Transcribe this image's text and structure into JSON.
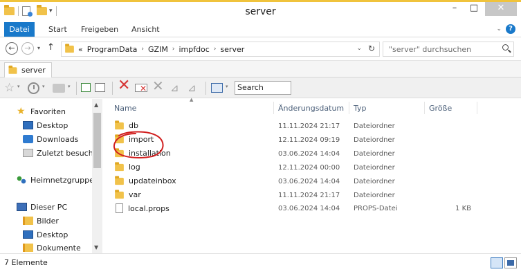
{
  "window": {
    "title": "server",
    "minimize": "–",
    "maximize": "□",
    "close": "✕"
  },
  "ribbon": {
    "tabs": [
      "Datei",
      "Start",
      "Freigeben",
      "Ansicht"
    ],
    "expand": "⌄",
    "help": "?"
  },
  "address": {
    "overflow": "«",
    "breadcrumbs": [
      "ProgramData",
      "GZIM",
      "impfdoc",
      "server"
    ],
    "separator": "›",
    "dropdown": "⌄",
    "refresh": "↻"
  },
  "search": {
    "placeholder": "\"server\" durchsuchen"
  },
  "folder_tab": {
    "label": "server"
  },
  "toolbar": {
    "search_label": "Search"
  },
  "nav": {
    "favorites": "Favoriten",
    "desktop": "Desktop",
    "downloads": "Downloads",
    "recent": "Zuletzt besucht",
    "homegroup": "Heimnetzgruppe",
    "this_pc": "Dieser PC",
    "pictures": "Bilder",
    "pc_desktop": "Desktop",
    "documents": "Dokumente"
  },
  "columns": {
    "name": "Name",
    "date": "Änderungsdatum",
    "type": "Typ",
    "size": "Größe"
  },
  "files": [
    {
      "name": "db",
      "date": "11.11.2024 21:17",
      "type": "Dateiordner",
      "size": "",
      "icon": "folder-icon"
    },
    {
      "name": "import",
      "date": "12.11.2024 09:19",
      "type": "Dateiordner",
      "size": "",
      "icon": "folder-icon"
    },
    {
      "name": "installation",
      "date": "03.06.2024 14:04",
      "type": "Dateiordner",
      "size": "",
      "icon": "folder-icon"
    },
    {
      "name": "log",
      "date": "12.11.2024 00:00",
      "type": "Dateiordner",
      "size": "",
      "icon": "folder-icon"
    },
    {
      "name": "updateinbox",
      "date": "03.06.2024 14:04",
      "type": "Dateiordner",
      "size": "",
      "icon": "folder-icon"
    },
    {
      "name": "var",
      "date": "11.11.2024 21:17",
      "type": "Dateiordner",
      "size": "",
      "icon": "folder-icon"
    },
    {
      "name": "local.props",
      "date": "03.06.2024 14:04",
      "type": "PROPS-Datei",
      "size": "1 KB",
      "icon": "file-icon"
    }
  ],
  "status": {
    "count": "7 Elemente"
  },
  "colors": {
    "accent": "#1979ca",
    "folder": "#f1c24a",
    "annotation": "#d11f1f"
  }
}
